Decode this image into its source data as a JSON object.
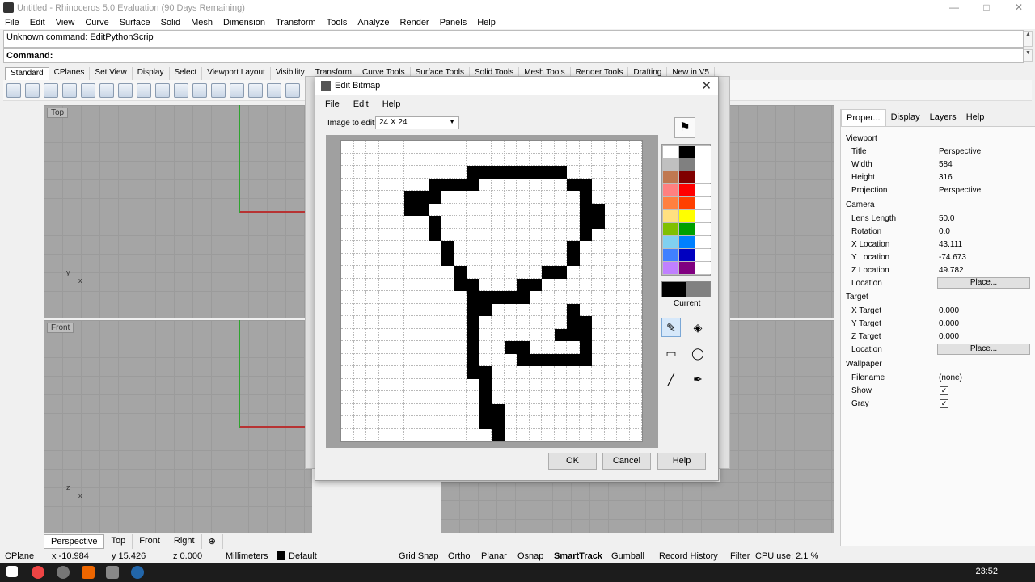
{
  "window": {
    "title": "Untitled - Rhinoceros 5.0 Evaluation (90 Days Remaining)"
  },
  "menu": [
    "File",
    "Edit",
    "View",
    "Curve",
    "Surface",
    "Solid",
    "Mesh",
    "Dimension",
    "Transform",
    "Tools",
    "Analyze",
    "Render",
    "Panels",
    "Help"
  ],
  "command": {
    "history": "Unknown command: EditPythonScrip",
    "prompt": "Command:"
  },
  "tooltabs": [
    "Standard",
    "CPlanes",
    "Set View",
    "Display",
    "Select",
    "Viewport Layout",
    "Visibility",
    "Transform",
    "Curve Tools",
    "Surface Tools",
    "Solid Tools",
    "Mesh Tools",
    "Render Tools",
    "Drafting",
    "New in V5"
  ],
  "viewports": {
    "top": "Top",
    "front": "Front"
  },
  "viewport_tabs": [
    "Perspective",
    "Top",
    "Front",
    "Right"
  ],
  "status": {
    "cplane": "CPlane",
    "x": "x -10.984",
    "y": "y 15.426",
    "z": "z 0.000",
    "units": "Millimeters",
    "layer": "Default",
    "toggles": [
      "Grid Snap",
      "Ortho",
      "Planar",
      "Osnap",
      "SmartTrack",
      "Gumball",
      "Record History",
      "Filter"
    ],
    "cpu": "CPU use: 2.1 %"
  },
  "clock": "23:52",
  "panel": {
    "tabs": [
      "Proper...",
      "Display",
      "Layers",
      "Help"
    ],
    "viewport_section": "Viewport",
    "viewport": [
      {
        "k": "Title",
        "v": "Perspective"
      },
      {
        "k": "Width",
        "v": "584"
      },
      {
        "k": "Height",
        "v": "316"
      },
      {
        "k": "Projection",
        "v": "Perspective"
      }
    ],
    "camera_section": "Camera",
    "camera": [
      {
        "k": "Lens Length",
        "v": "50.0"
      },
      {
        "k": "Rotation",
        "v": "0.0"
      },
      {
        "k": "X Location",
        "v": "43.111"
      },
      {
        "k": "Y Location",
        "v": "-74.673"
      },
      {
        "k": "Z Location",
        "v": "49.782"
      }
    ],
    "location_label": "Location",
    "place_label": "Place...",
    "target_section": "Target",
    "target": [
      {
        "k": "X Target",
        "v": "0.000"
      },
      {
        "k": "Y Target",
        "v": "0.000"
      },
      {
        "k": "Z Target",
        "v": "0.000"
      }
    ],
    "wallpaper_section": "Wallpaper",
    "wallpaper": [
      {
        "k": "Filename",
        "v": "(none)"
      },
      {
        "k": "Show",
        "v": ""
      },
      {
        "k": "Gray",
        "v": ""
      }
    ]
  },
  "dialog": {
    "title": "Edit Bitmap",
    "menu": [
      "File",
      "Edit",
      "Help"
    ],
    "image_label": "Image to edit:",
    "image_value": "24 X 24",
    "current_label": "Current",
    "ok": "OK",
    "cancel": "Cancel",
    "help": "Help",
    "palette": [
      "#ffffff",
      "#000000",
      "#ffffff",
      "#c0c0c0",
      "#808080",
      "#ffffff",
      "#c07850",
      "#800000",
      "#ffffff",
      "#ff8080",
      "#ff0000",
      "#ffffff",
      "#ff8040",
      "#ff4000",
      "#ffffff",
      "#ffe080",
      "#ffff00",
      "#ffffff",
      "#80c000",
      "#00a000",
      "#ffffff",
      "#80d0f0",
      "#0080ff",
      "#ffffff",
      "#4080ff",
      "#0000c0",
      "#ffffff",
      "#c080ff",
      "#800080",
      "#ffffff"
    ],
    "bitmap_rows": [
      "........................",
      "........................",
      "..........xxxxxxxx......",
      ".......xxxx.......xx....",
      ".....xxx...........x....",
      ".....xx............xx...",
      ".......x...........xx...",
      ".......x...........x....",
      "........x.........x.....",
      "........x.........x.....",
      ".........x......xx......",
      ".........xx...xx........",
      "..........xxxxx.........",
      "..........xx......x.....",
      "..........x.......xx....",
      "..........x......xxx....",
      "..........x..xx....x....",
      "..........x...xxxxxx....",
      "..........xx............",
      "...........x............",
      "...........x............",
      "...........xx...........",
      "...........xx...........",
      "............x..........."
    ]
  }
}
